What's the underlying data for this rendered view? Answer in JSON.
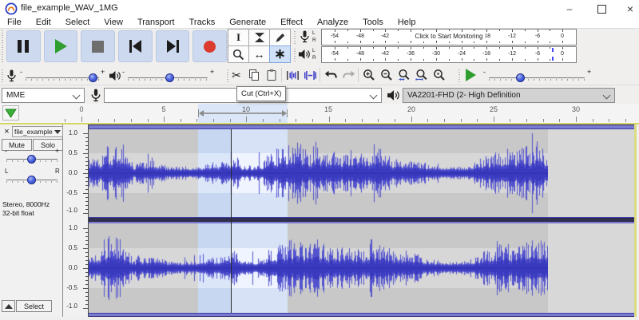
{
  "window": {
    "title": "file_example_WAV_1MG"
  },
  "window_controls": {
    "minimize": "–",
    "close": "×"
  },
  "menu": {
    "items": [
      "File",
      "Edit",
      "Select",
      "View",
      "Transport",
      "Tracks",
      "Generate",
      "Effect",
      "Analyze",
      "Tools",
      "Help"
    ]
  },
  "transport": {
    "buttons": [
      "pause",
      "play",
      "stop",
      "skip-to-start",
      "skip-to-end",
      "record"
    ]
  },
  "tools": {
    "buttons": [
      "selection",
      "envelope",
      "draw",
      "zoom",
      "time-shift",
      "multi"
    ],
    "selected": "multi"
  },
  "meters": {
    "recording": {
      "channels": [
        "L",
        "R"
      ],
      "overlay": "Click to Start Monitoring",
      "scale": [
        "-54",
        "-48",
        "-42",
        "",
        "",
        "",
        "-18",
        "-12",
        "-6",
        "0"
      ]
    },
    "playback": {
      "channels": [
        "L",
        "R"
      ],
      "scale": [
        "-54",
        "-48",
        "-42",
        "-36",
        "-30",
        "-24",
        "-18",
        "-12",
        "-6",
        "0"
      ]
    }
  },
  "mixer": {
    "record_volume_pct": 92,
    "playback_volume_pct": 52,
    "minus": "-",
    "plus": "+"
  },
  "edit": {
    "buttons": [
      "cut",
      "copy",
      "paste",
      "trim-outside-selection",
      "silence-selection",
      "undo",
      "redo",
      "zoom-in",
      "zoom-out",
      "fit-selection",
      "fit-project",
      "zoom-toggle"
    ]
  },
  "play_at_speed": {
    "position_pct": 33,
    "minus": "-",
    "plus": "+"
  },
  "tooltip": {
    "text": "Cut (Ctrl+X)"
  },
  "devices": {
    "host": "MME",
    "recording_device": "",
    "playback_device": "VA2201-FHD (2- High Definition"
  },
  "timeline": {
    "labels": [
      "0",
      "5",
      "10",
      "15",
      "20",
      "25",
      "30"
    ],
    "selection_start_s": 7.08,
    "selection_end_s": 12.51
  },
  "track": {
    "name": "file_example",
    "mute": "Mute",
    "solo": "Solo",
    "gain_min": "-",
    "gain_max": "+",
    "pan_left": "L",
    "pan_right": "R",
    "info": [
      "Stereo, 8000Hz",
      "32-bit float"
    ],
    "select_button": "Select",
    "ruler_labels": [
      "1.0",
      "0.5",
      "0.0",
      "-0.5",
      "-1.0"
    ],
    "cursor_s": 9.07,
    "audio_end_s": 28.3
  },
  "colors": {
    "waveform": "#5353cf",
    "waveform_core": "#3a3abf",
    "selection": "#eff4fe",
    "record_red": "#dd3a2e",
    "play_green": "#2f9e2f",
    "meter_peak": "#4646ff",
    "focus_border": "#d6d666"
  }
}
